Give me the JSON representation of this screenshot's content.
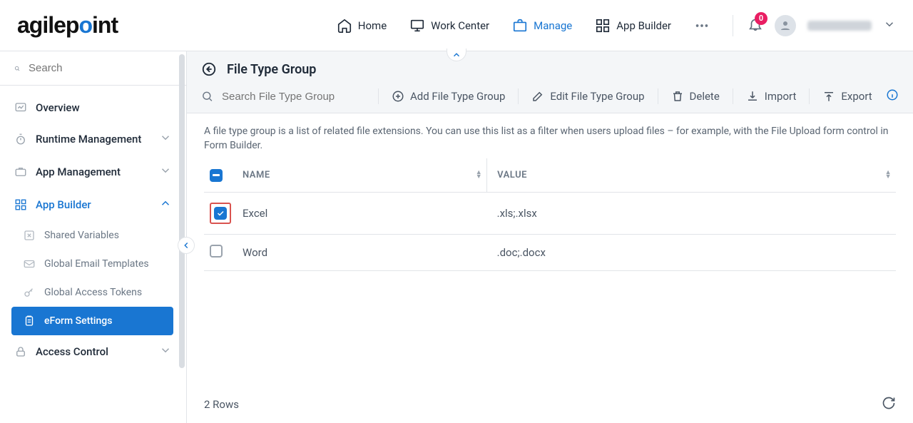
{
  "logo_text": "agilepoint",
  "nav": {
    "home": "Home",
    "work_center": "Work Center",
    "manage": "Manage",
    "app_builder": "App Builder"
  },
  "notifications_count": "0",
  "sidebar": {
    "search_placeholder": "Search",
    "overview": "Overview",
    "runtime_mgmt": "Runtime Management",
    "app_mgmt": "App Management",
    "app_builder": "App Builder",
    "shared_vars": "Shared Variables",
    "email_templates": "Global Email Templates",
    "access_tokens": "Global Access Tokens",
    "eform_settings": "eForm Settings",
    "access_control": "Access Control"
  },
  "page": {
    "title": "File Type Group",
    "search_placeholder": "Search File Type Group",
    "add": "Add File Type Group",
    "edit": "Edit File Type Group",
    "delete": "Delete",
    "import": "Import",
    "export": "Export",
    "description": "A file type group is a list of related file extensions. You can use this list as a filter when users upload files – for example, with the File Upload form control in Form Builder."
  },
  "table": {
    "col_name": "NAME",
    "col_value": "VALUE",
    "rows": [
      {
        "checked": true,
        "name": "Excel",
        "value": ".xls;.xlsx"
      },
      {
        "checked": false,
        "name": "Word",
        "value": ".doc;.docx"
      }
    ],
    "footer": "2 Rows"
  }
}
